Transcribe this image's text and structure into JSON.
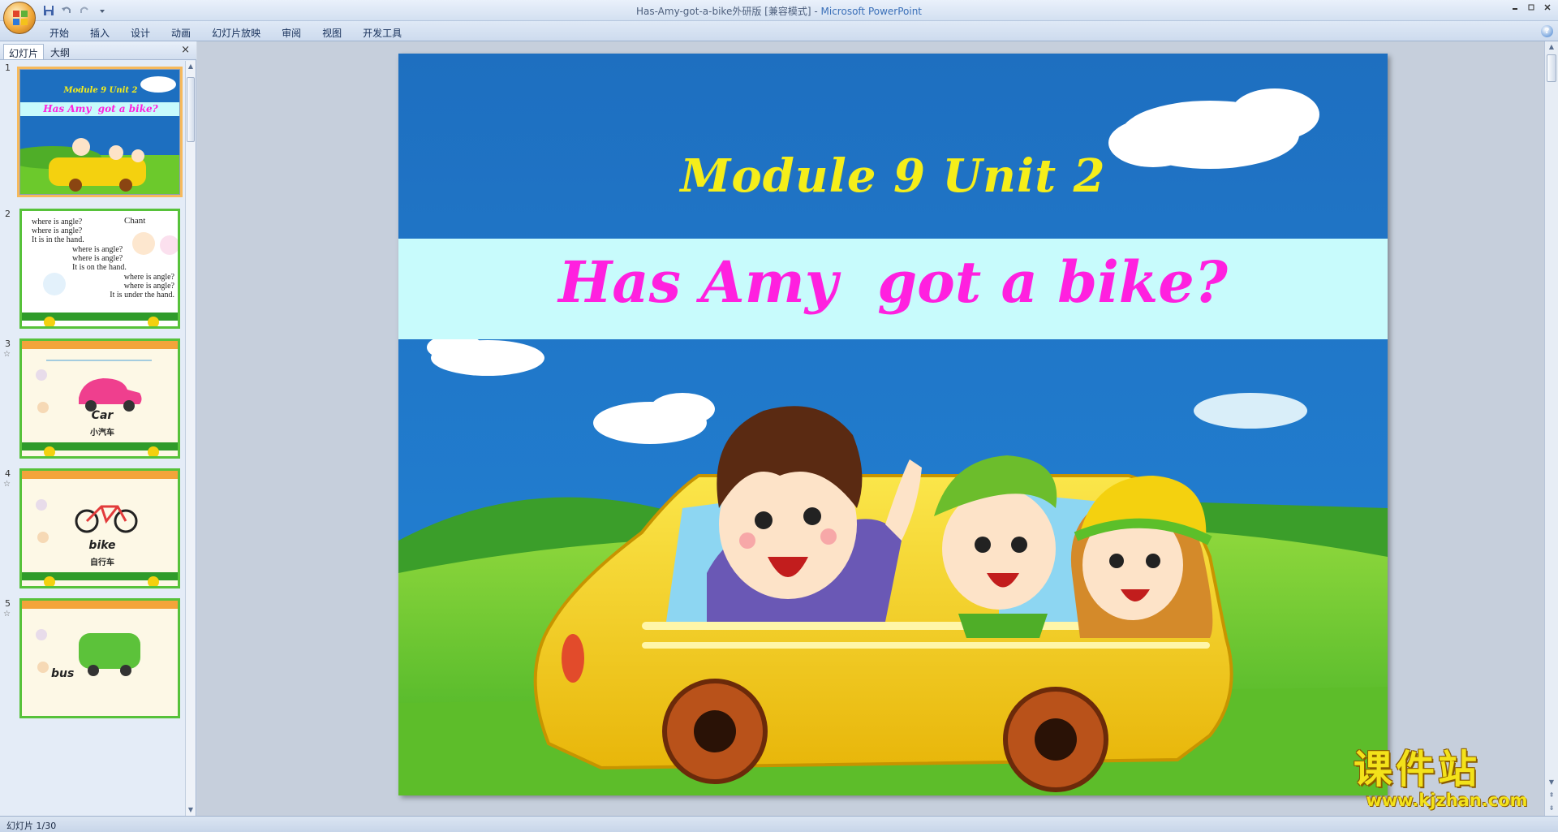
{
  "window": {
    "title": "Has-Amy-got-a-bike外研版 [兼容模式]",
    "title_separator": "-",
    "app_name": "Microsoft PowerPoint"
  },
  "ribbon": {
    "tabs": [
      "开始",
      "插入",
      "设计",
      "动画",
      "幻灯片放映",
      "审阅",
      "视图",
      "开发工具"
    ]
  },
  "left_panel": {
    "tabs": [
      "幻灯片",
      "大纲"
    ],
    "active_tab": "幻灯片",
    "close_glyph": "×",
    "thumbnails": [
      {
        "number": "1",
        "module": "Module 9 Unit 2",
        "question": "Has Amy  got a bike?"
      },
      {
        "number": "2",
        "title": "Chant",
        "lines": [
          "where is angle?",
          "where is angle?",
          "It is in the hand.",
          "where is angle?",
          "where is angle?",
          "It is on the hand.",
          "where is angle?",
          "where is angle?",
          "It is under the hand."
        ]
      },
      {
        "number": "3",
        "word": "Car",
        "chinese": "小汽车"
      },
      {
        "number": "4",
        "word": "bike",
        "chinese": "自行车"
      },
      {
        "number": "5",
        "word": "bus"
      }
    ],
    "star_glyph": "☆"
  },
  "slide": {
    "module_title": "Module 9 Unit 2",
    "question": "Has Amy  got a bike?",
    "colors": {
      "sky": "#1d6fc0",
      "band": "#c8fbfc",
      "module_text": "#f5ee1a",
      "question_text": "#ff20df",
      "grass": "#6cc92c",
      "car": "#f4d10f"
    }
  },
  "watermark": {
    "main": "课件站",
    "url": "www.kjzhan.com"
  },
  "status_bar": {
    "slide_indicator": "幻灯片 1/30"
  }
}
